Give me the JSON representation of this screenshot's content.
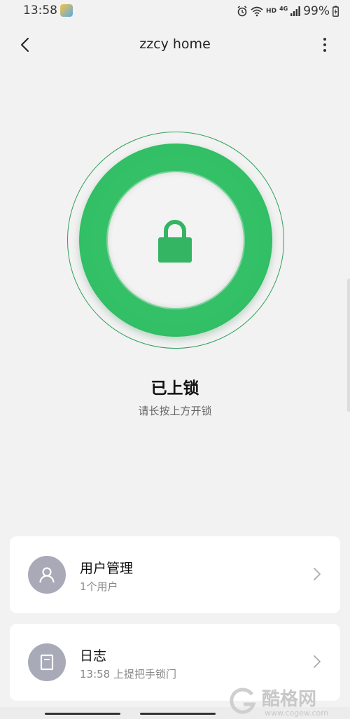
{
  "status_bar": {
    "time": "13:58",
    "battery": "99%",
    "hd_label": "HD",
    "network_label": "4G"
  },
  "header": {
    "title": "zzcy home"
  },
  "lock": {
    "status": "已上锁",
    "hint": "请长按上方开锁",
    "accent_color": "#33c066"
  },
  "cards": {
    "users": {
      "title": "用户管理",
      "subtitle": "1个用户"
    },
    "log": {
      "title": "日志",
      "subtitle": "13:58 上提把手锁门"
    }
  },
  "watermark": {
    "text": "酷格网",
    "url": "www.cogew.com"
  }
}
